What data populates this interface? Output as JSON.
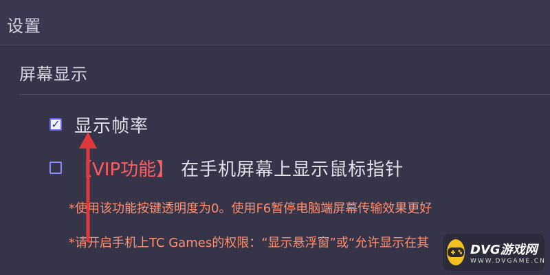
{
  "window": {
    "title": "设置"
  },
  "section": {
    "title": "屏幕显示"
  },
  "options": [
    {
      "checked": true,
      "label": "显示帧率"
    },
    {
      "checked": false,
      "vip_tag": "【VIP功能】",
      "label": "在手机屏幕上显示鼠标指针"
    }
  ],
  "notes": [
    "*使用该功能按键透明度为0。使用F6暂停电脑端屏幕传输效果更好",
    "*请开启手机上TC Games的权限：“显示悬浮窗”或“允许显示在其"
  ],
  "watermark": {
    "brand": "DVG游戏网",
    "url": "WWW.DVGAME.CN"
  },
  "colors": {
    "background": "#363449",
    "note_text": "#ff8f6e",
    "vip_text": "#ff5d5d",
    "arrow": "#e0393b"
  }
}
